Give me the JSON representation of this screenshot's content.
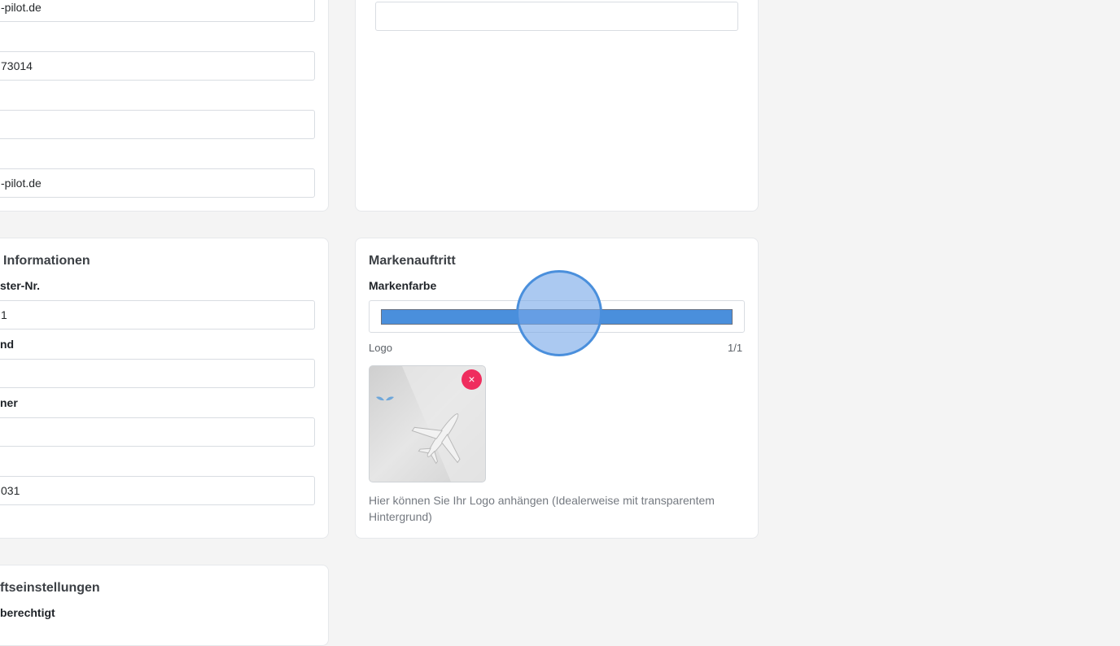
{
  "left_column": {
    "contact_card": {
      "fields": [
        {
          "value": "-pilot.de"
        },
        {
          "value": "73014"
        },
        {
          "value": ""
        },
        {
          "value": "-pilot.de"
        }
      ]
    },
    "info_card": {
      "title": "Informationen",
      "fields": [
        {
          "label": "ster-Nr.",
          "value": "1"
        },
        {
          "label": "nd",
          "value": ""
        },
        {
          "label": "ner",
          "value": ""
        },
        {
          "label": "",
          "value": "031"
        }
      ]
    },
    "settings_card": {
      "title": "ftseinstellungen",
      "first_label": "berechtigt"
    }
  },
  "top_right_card": {
    "input_value": ""
  },
  "brand_card": {
    "title": "Markenauftritt",
    "color_label": "Markenfarbe",
    "color_value": "#4a8fdc",
    "logo_label": "Logo",
    "logo_count": "1/1",
    "remove_icon": "×",
    "help_text": "Hier können Sie Ihr Logo anhängen (Idealerweise mit transparentem Hintergrund)"
  },
  "colors": {
    "accent": "#4a8fdc",
    "remove": "#ef2d5e",
    "background": "#f4f4f4"
  }
}
